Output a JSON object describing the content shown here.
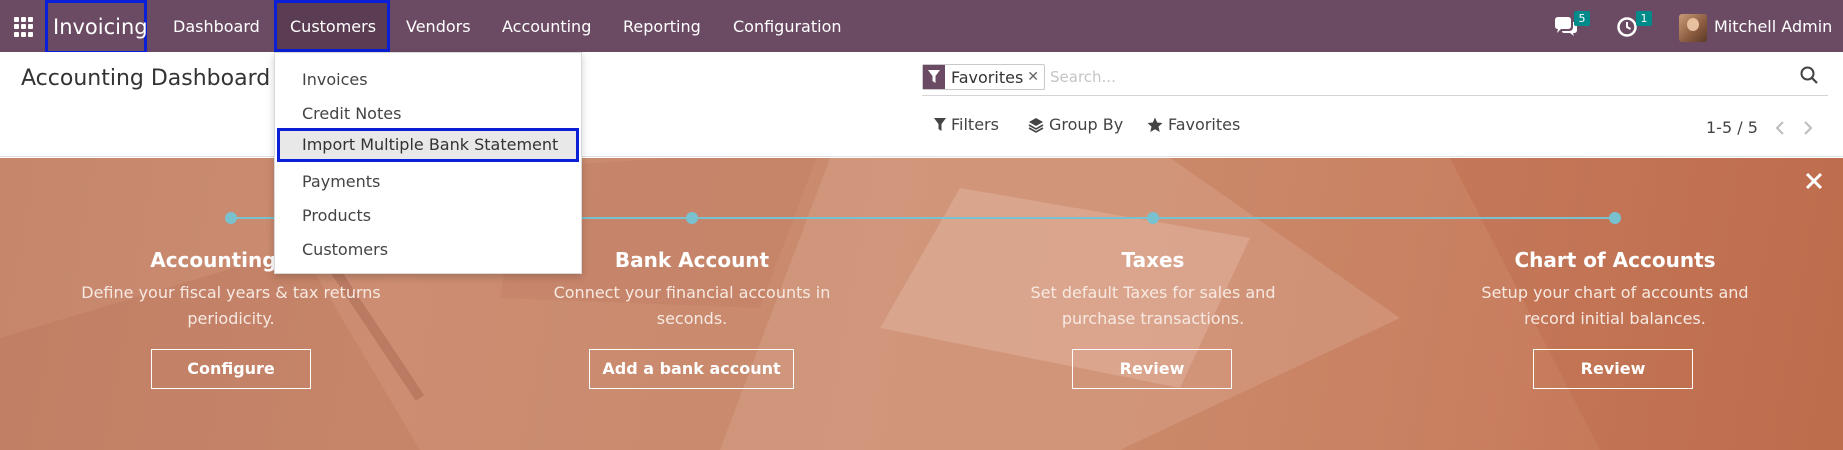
{
  "navbar": {
    "brand": "Invoicing",
    "menu": [
      "Dashboard",
      "Customers",
      "Vendors",
      "Accounting",
      "Reporting",
      "Configuration"
    ],
    "messages_count": "5",
    "activities_count": "1",
    "user_name": "Mitchell Admin",
    "colors": {
      "bar": "#6b4b63",
      "active": "#5a3d52",
      "badge": "#018a8a",
      "highlight_border": "#0a1fd6"
    }
  },
  "control_panel": {
    "title": "Accounting Dashboard",
    "facet": "Favorites",
    "search_placeholder": "Search...",
    "filters_label": "Filters",
    "group_by_label": "Group By",
    "favorites_label": "Favorites",
    "pager": "1-5 / 5"
  },
  "dropdown": {
    "items": [
      "Invoices",
      "Credit Notes",
      "Import Multiple Bank Statement",
      "Payments",
      "Products",
      "Customers"
    ],
    "highlighted_index": 2
  },
  "onboarding": {
    "steps": [
      {
        "title": "Accounting Pe",
        "description": "Define your fiscal years & tax returns periodicity.",
        "button": "Configure"
      },
      {
        "title": "Bank Account",
        "description": "Connect your financial accounts in seconds.",
        "button": "Add a bank account"
      },
      {
        "title": "Taxes",
        "description": "Set default Taxes for sales and purchase transactions.",
        "button": "Review"
      },
      {
        "title": "Chart of Accounts",
        "description": "Setup your chart of accounts and record initial balances.",
        "button": "Review"
      }
    ],
    "colors": {
      "timeline": "#79c1cf",
      "banner": "#c98a6e"
    }
  }
}
